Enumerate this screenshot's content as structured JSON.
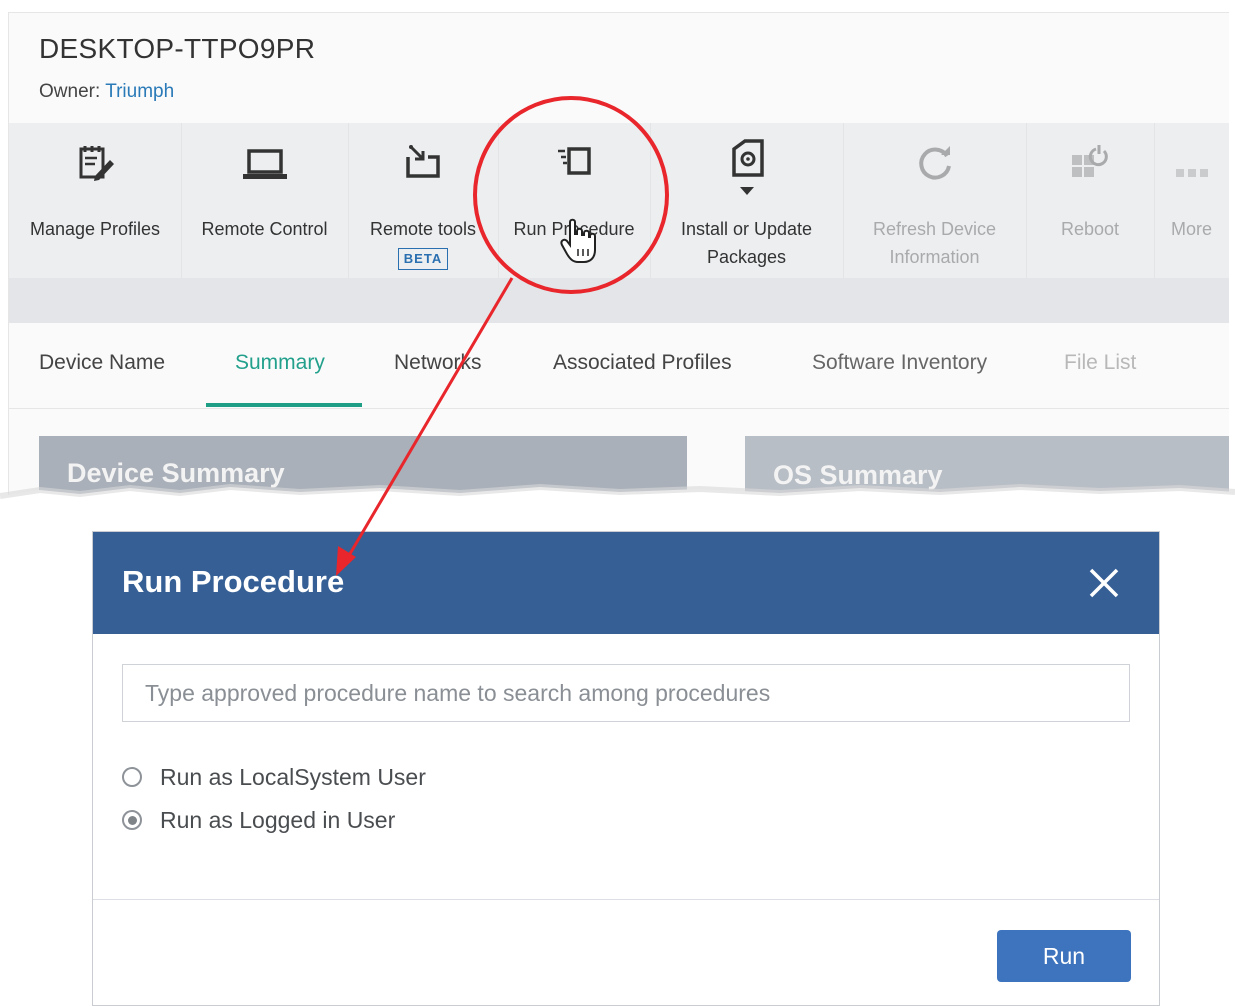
{
  "device": {
    "name": "DESKTOP-TTPO9PR",
    "owner_label": "Owner: ",
    "owner_name": "Triumph"
  },
  "toolbar": {
    "manage_profiles": "Manage Profiles",
    "remote_control": "Remote Control",
    "remote_tools": "Remote tools",
    "remote_tools_badge": "BETA",
    "run_procedure": "Run Procedure",
    "install_line1": "Install or Update",
    "install_line2": "Packages",
    "refresh_line1": "Refresh Device",
    "refresh_line2": "Information",
    "reboot": "Reboot",
    "more": "More"
  },
  "tabs": {
    "device_name": "Device Name",
    "summary": "Summary",
    "networks": "Networks",
    "associated_profiles": "Associated Profiles",
    "software_inventory": "Software Inventory",
    "file_list": "File List"
  },
  "panels": {
    "device_summary": "Device Summary",
    "os_summary": "OS Summary"
  },
  "modal": {
    "title": "Run Procedure",
    "search_placeholder": "Type approved procedure name to search among procedures",
    "search_value": "",
    "options": [
      {
        "label": "Run as LocalSystem User",
        "selected": false
      },
      {
        "label": "Run as Logged in User",
        "selected": true
      }
    ],
    "run_button": "Run"
  },
  "colors": {
    "modal_header": "#355f95",
    "run_button": "#3d74bd",
    "active_tab": "#22a08c",
    "annotation": "#e8262b"
  },
  "icons": {
    "manage_profiles": "notepad-pencil-icon",
    "remote_control": "laptop-icon",
    "remote_tools": "remote-tools-icon",
    "run_procedure": "run-procedure-icon",
    "install": "package-install-icon",
    "refresh": "refresh-icon",
    "reboot": "reboot-icon",
    "more": "more-dots-icon",
    "close": "close-icon",
    "cursor": "hand-pointer-icon"
  }
}
